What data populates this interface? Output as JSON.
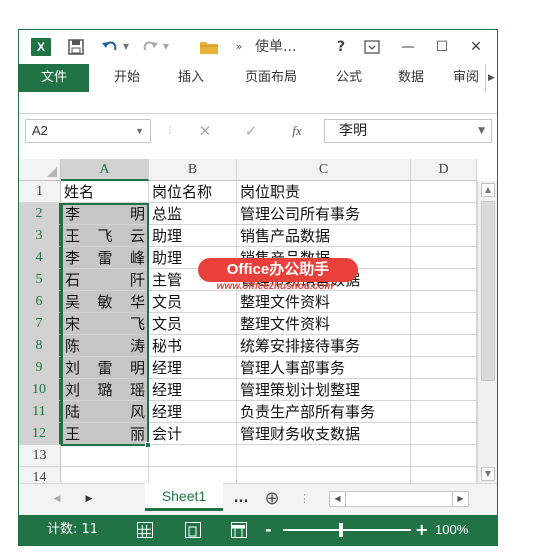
{
  "titlebar": {
    "app_icon_letter": "X",
    "title_truncated": "使单...",
    "help": "?",
    "min": "—",
    "max": "☐",
    "close": "✕"
  },
  "ribbon": {
    "tabs": [
      "文件",
      "开始",
      "插入",
      "页面布局",
      "公式",
      "数据",
      "审阅"
    ]
  },
  "formula_bar": {
    "name_box": "A2",
    "fx": "fx",
    "value": "李明"
  },
  "grid": {
    "columns": [
      "A",
      "B",
      "C",
      "D"
    ],
    "rows": [
      "1",
      "2",
      "3",
      "4",
      "5",
      "6",
      "7",
      "8",
      "9",
      "10",
      "11",
      "12",
      "13",
      "14"
    ],
    "cells": [
      [
        "姓名",
        "岗位名称",
        "岗位职责"
      ],
      [
        "李明",
        "总监",
        "管理公司所有事务"
      ],
      [
        "王飞云",
        "助理",
        "销售产品数据"
      ],
      [
        "李雷峰",
        "助理",
        "销售产品数据"
      ],
      [
        "石阡",
        "主管",
        "管理市场销售数据"
      ],
      [
        "吴敏华",
        "文员",
        "整理文件资料"
      ],
      [
        "宋飞",
        "文员",
        "整理文件资料"
      ],
      [
        "陈涛",
        "秘书",
        "统筹安排接待事务"
      ],
      [
        "刘雷明",
        "经理",
        "管理人事部事务"
      ],
      [
        "刘璐瑶",
        "经理",
        "管理策划计划整理"
      ],
      [
        "陆风",
        "经理",
        "负责生产部所有事务"
      ],
      [
        "王丽",
        "会计",
        "管理财务收支数据"
      ],
      [
        "",
        "",
        ""
      ],
      [
        "",
        "",
        ""
      ]
    ]
  },
  "watermark": {
    "badge": "Office办公助手",
    "url": "www.officezhushou.com"
  },
  "sheetbar": {
    "prev": "◀",
    "next": "▶",
    "sheet_name": "Sheet1",
    "more": "...",
    "add": "⊕"
  },
  "statusbar": {
    "count": "计数: 11",
    "zoom_minus": "-",
    "zoom_plus": "+",
    "zoom": "100%"
  },
  "colors": {
    "accent": "#217346",
    "selection": "#c6c6c6",
    "watermark": "#e8413c"
  }
}
